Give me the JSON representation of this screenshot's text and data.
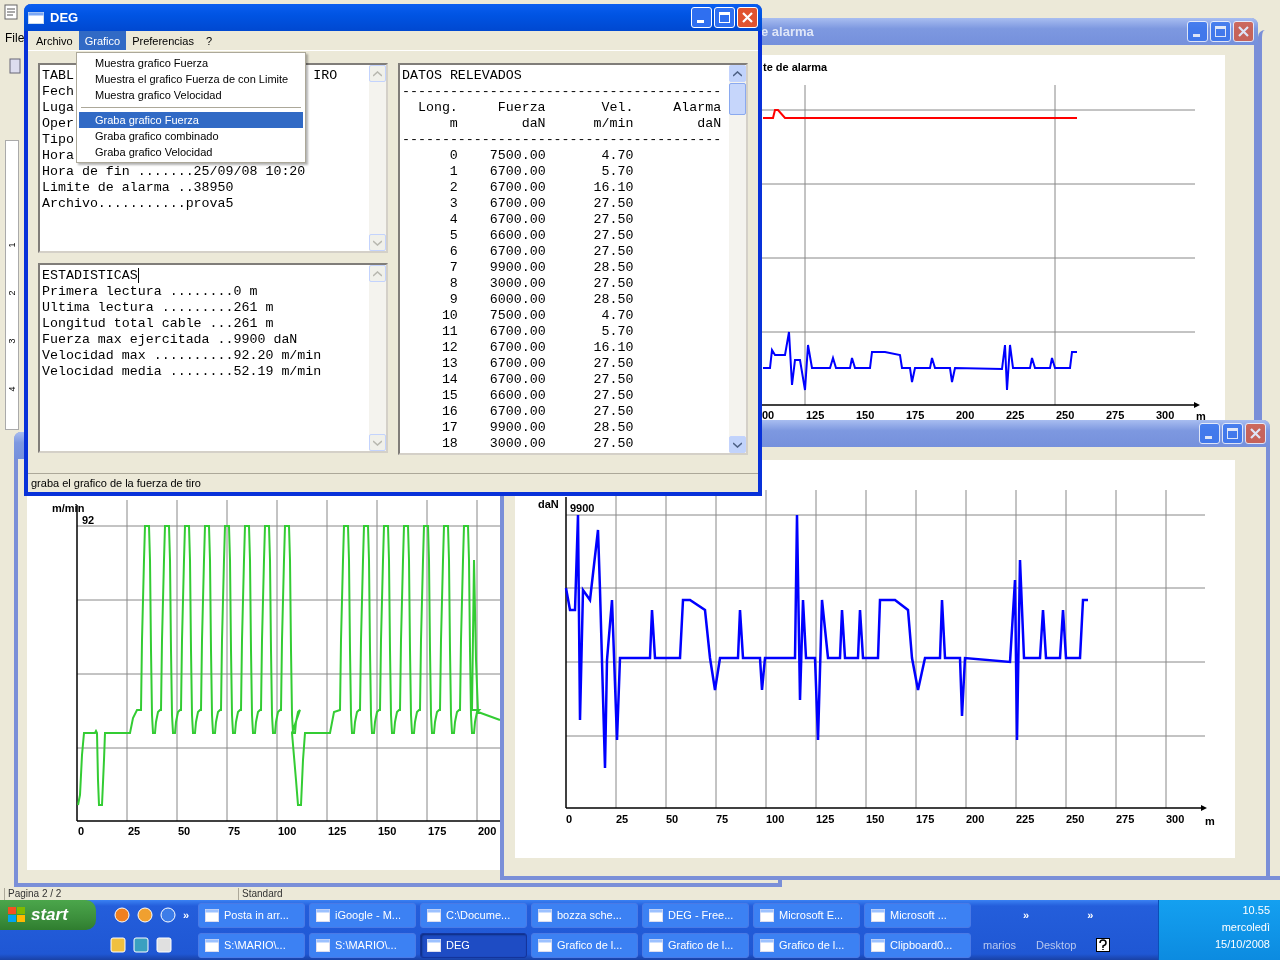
{
  "background_window": {
    "menu_item": "File",
    "ruler_numbers": [
      "1",
      "2",
      "3",
      "4"
    ],
    "status_fields": [
      "Pagina 2 / 2",
      "Standard"
    ]
  },
  "alarm_chart_window": {
    "title": "e alarma",
    "chart_title": "te de alarma",
    "x_tick_labels": [
      "00",
      "125",
      "150",
      "175",
      "200",
      "225",
      "250",
      "275",
      "300"
    ],
    "x_unit": "m"
  },
  "speed_chart_window": {
    "y_unit": "m/min",
    "y_max_label": "92",
    "x_tick_labels": [
      "0",
      "25",
      "50",
      "75",
      "100",
      "125",
      "150",
      "175",
      "200"
    ]
  },
  "force_chart_window": {
    "y_unit": "daN",
    "y_max_label": "9900",
    "x_tick_labels": [
      "0",
      "25",
      "50",
      "75",
      "100",
      "125",
      "150",
      "175",
      "200",
      "225",
      "250",
      "275",
      "300"
    ],
    "x_unit": "m"
  },
  "main_window": {
    "title": "DEG",
    "menu": [
      {
        "label": "Archivo",
        "selected": false
      },
      {
        "label": "Grafico",
        "selected": true
      },
      {
        "label": "Preferencias",
        "selected": false
      },
      {
        "label": "?",
        "selected": false
      }
    ],
    "dropdown": [
      {
        "kind": "item",
        "label": "Muestra grafico Fuerza",
        "selected": false
      },
      {
        "kind": "item",
        "label": "Muestra el grafico Fuerza de con Limite",
        "selected": false
      },
      {
        "kind": "item",
        "label": "Muestra grafico Velocidad",
        "selected": false
      },
      {
        "kind": "separator"
      },
      {
        "kind": "item",
        "label": "Graba grafico Fuerza",
        "selected": true
      },
      {
        "kind": "item",
        "label": "Graba grafico combinado",
        "selected": false
      },
      {
        "kind": "item",
        "label": "Graba grafico Velocidad",
        "selected": false
      }
    ],
    "info_lines": [
      {
        "text": "TABL",
        "tail": "IRO"
      },
      {
        "text": "Fech"
      },
      {
        "text": "Luga"
      },
      {
        "text": "Oper"
      },
      {
        "text": "Tipo"
      },
      {
        "text": "Hora"
      },
      {
        "text": "Hora de fin .......25/09/08 10:20"
      },
      {
        "text": "Limite de alarma ..38950"
      },
      {
        "text": "Archivo...........prova5"
      }
    ],
    "stats_lines": [
      "ESTADISTICAS",
      "Primera lectura ........0 m",
      "Ultima lectura .........261 m",
      "Longitud total cable ...261 m",
      "Fuerza max ejercitada ..9900 daN",
      "Velocidad max ..........92.20 m/min",
      "Velocidad media ........52.19 m/min"
    ],
    "data_title": "DATOS RELEVADOS",
    "rule": "----------------------------------------",
    "columns": [
      {
        "name": "Long.",
        "unit": "m"
      },
      {
        "name": "Fuerza",
        "unit": "daN"
      },
      {
        "name": "Vel.",
        "unit": "m/min"
      },
      {
        "name": "Alarma",
        "unit": "daN"
      }
    ],
    "rows": [
      [
        "0",
        "7500.00",
        "4.70"
      ],
      [
        "1",
        "6700.00",
        "5.70"
      ],
      [
        "2",
        "6700.00",
        "16.10"
      ],
      [
        "3",
        "6700.00",
        "27.50"
      ],
      [
        "4",
        "6700.00",
        "27.50"
      ],
      [
        "5",
        "6600.00",
        "27.50"
      ],
      [
        "6",
        "6700.00",
        "27.50"
      ],
      [
        "7",
        "9900.00",
        "28.50"
      ],
      [
        "8",
        "3000.00",
        "27.50"
      ],
      [
        "9",
        "6000.00",
        "28.50"
      ],
      [
        "10",
        "7500.00",
        "4.70"
      ],
      [
        "11",
        "6700.00",
        "5.70"
      ],
      [
        "12",
        "6700.00",
        "16.10"
      ],
      [
        "13",
        "6700.00",
        "27.50"
      ],
      [
        "14",
        "6700.00",
        "27.50"
      ],
      [
        "15",
        "6600.00",
        "27.50"
      ],
      [
        "16",
        "6700.00",
        "27.50"
      ],
      [
        "17",
        "9900.00",
        "28.50"
      ],
      [
        "18",
        "3000.00",
        "27.50"
      ]
    ],
    "status_bar": "graba el grafico de la fuerza de tiro"
  },
  "taskbar": {
    "start": "start",
    "top_row": [
      {
        "label": "Posta in arr...",
        "selected": false
      },
      {
        "label": "iGoogle - M...",
        "selected": false
      },
      {
        "label": "C:\\Docume...",
        "selected": false
      },
      {
        "label": "bozza sche...",
        "selected": false
      },
      {
        "label": "DEG - Free...",
        "selected": false
      },
      {
        "label": "Microsoft E...",
        "selected": false
      },
      {
        "label": "Microsoft ...",
        "selected": false
      }
    ],
    "bottom_row": [
      {
        "label": "S:\\MARIO\\...",
        "selected": false
      },
      {
        "label": "S:\\MARIO\\...",
        "selected": false
      },
      {
        "label": "DEG",
        "selected": true
      },
      {
        "label": "Grafico de l...",
        "selected": false
      },
      {
        "label": "Grafico de l...",
        "selected": false
      },
      {
        "label": "Grafico de l...",
        "selected": false
      },
      {
        "label": "Clipboard0...",
        "selected": false
      }
    ],
    "chevrons": [
      "»",
      "»",
      "»"
    ],
    "toolbars": [
      "marios",
      "Desktop"
    ],
    "clock": {
      "time": "10.55",
      "day": "mercoledì",
      "date": "15/10/2008"
    }
  }
}
